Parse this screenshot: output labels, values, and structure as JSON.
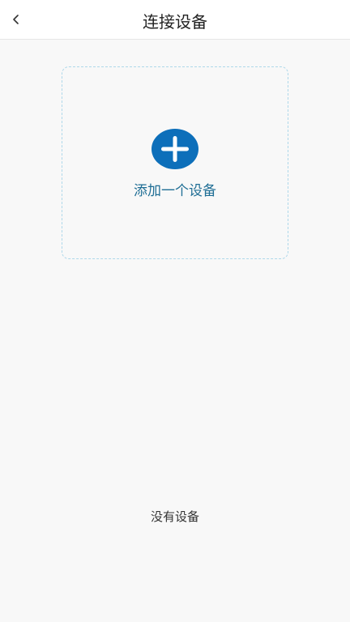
{
  "header": {
    "title": "连接设备",
    "back_icon": "chevron-left-icon"
  },
  "add_device": {
    "label": "添加一个设备",
    "icon": "plus-circle-icon",
    "icon_color": "#0d6fba",
    "label_color": "#1f6e95",
    "border_color": "#aed8ea"
  },
  "empty_state": {
    "text": "没有设备"
  },
  "colors": {
    "background": "#f8f8f8",
    "header_background": "#ffffff"
  }
}
